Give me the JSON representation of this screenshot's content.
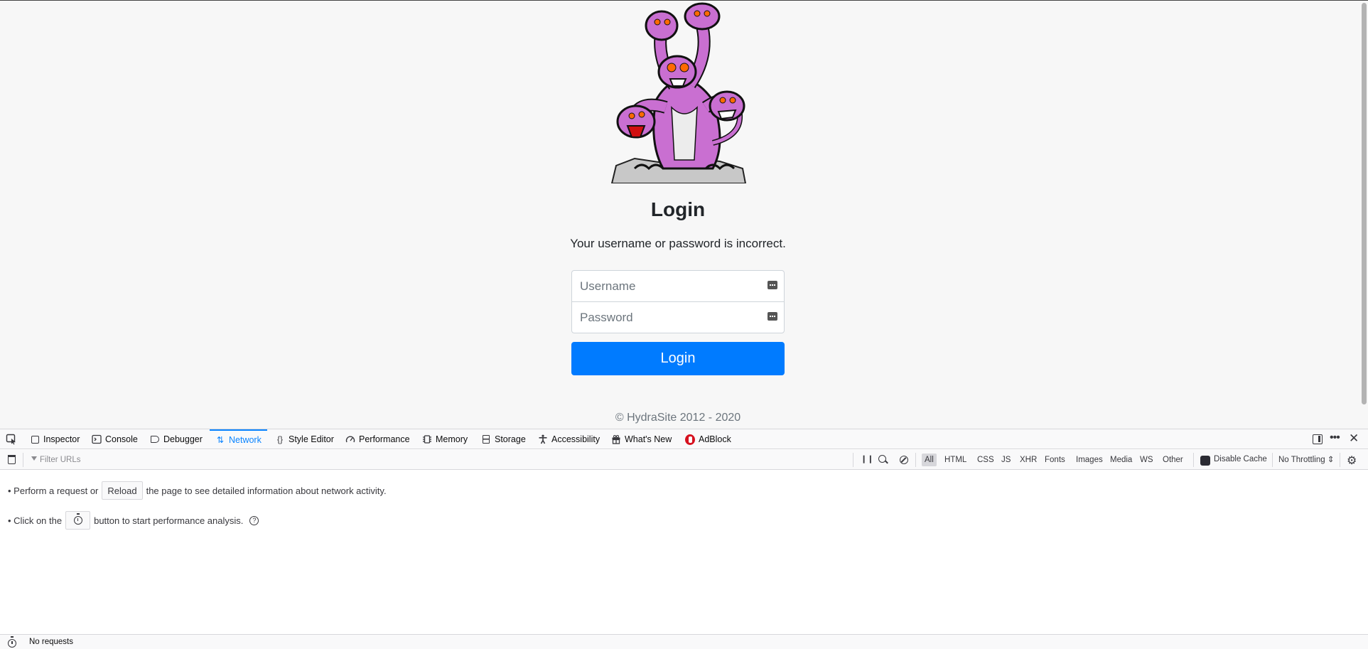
{
  "page": {
    "title": "Login",
    "message": "Your username or password is incorrect.",
    "username_placeholder": "Username",
    "password_placeholder": "Password",
    "login_button": "Login",
    "footer": "© HydraSite 2012 - 2020",
    "colors": {
      "primary": "#007bff",
      "background": "#f7f7f7"
    }
  },
  "devtools": {
    "tabs": [
      {
        "label": "Inspector",
        "icon": "box-icon"
      },
      {
        "label": "Console",
        "icon": "console-icon"
      },
      {
        "label": "Debugger",
        "icon": "tag-icon"
      },
      {
        "label": "Network",
        "icon": "arrows-icon",
        "selected": true
      },
      {
        "label": "Style Editor",
        "icon": "braces-icon"
      },
      {
        "label": "Performance",
        "icon": "gauge-icon"
      },
      {
        "label": "Memory",
        "icon": "chip-icon"
      },
      {
        "label": "Storage",
        "icon": "database-icon"
      },
      {
        "label": "Accessibility",
        "icon": "person-icon"
      },
      {
        "label": "What's New",
        "icon": "gift-icon"
      },
      {
        "label": "AdBlock",
        "icon": "adblock-icon"
      }
    ],
    "filter_placeholder": "Filter URLs",
    "type_filters": [
      "All",
      "HTML",
      "CSS",
      "JS",
      "XHR",
      "Fonts",
      "Images",
      "Media",
      "WS",
      "Other"
    ],
    "disable_cache": "Disable Cache",
    "throttling": "No Throttling ⇕",
    "notices": {
      "reload_pre": "• Perform a request or",
      "reload_button": "Reload",
      "reload_post": "the page to see detailed information about network activity.",
      "perf_pre": "• Click on the",
      "perf_post": "button to start performance analysis."
    },
    "status": "No requests",
    "accent": "#0a84ff"
  }
}
